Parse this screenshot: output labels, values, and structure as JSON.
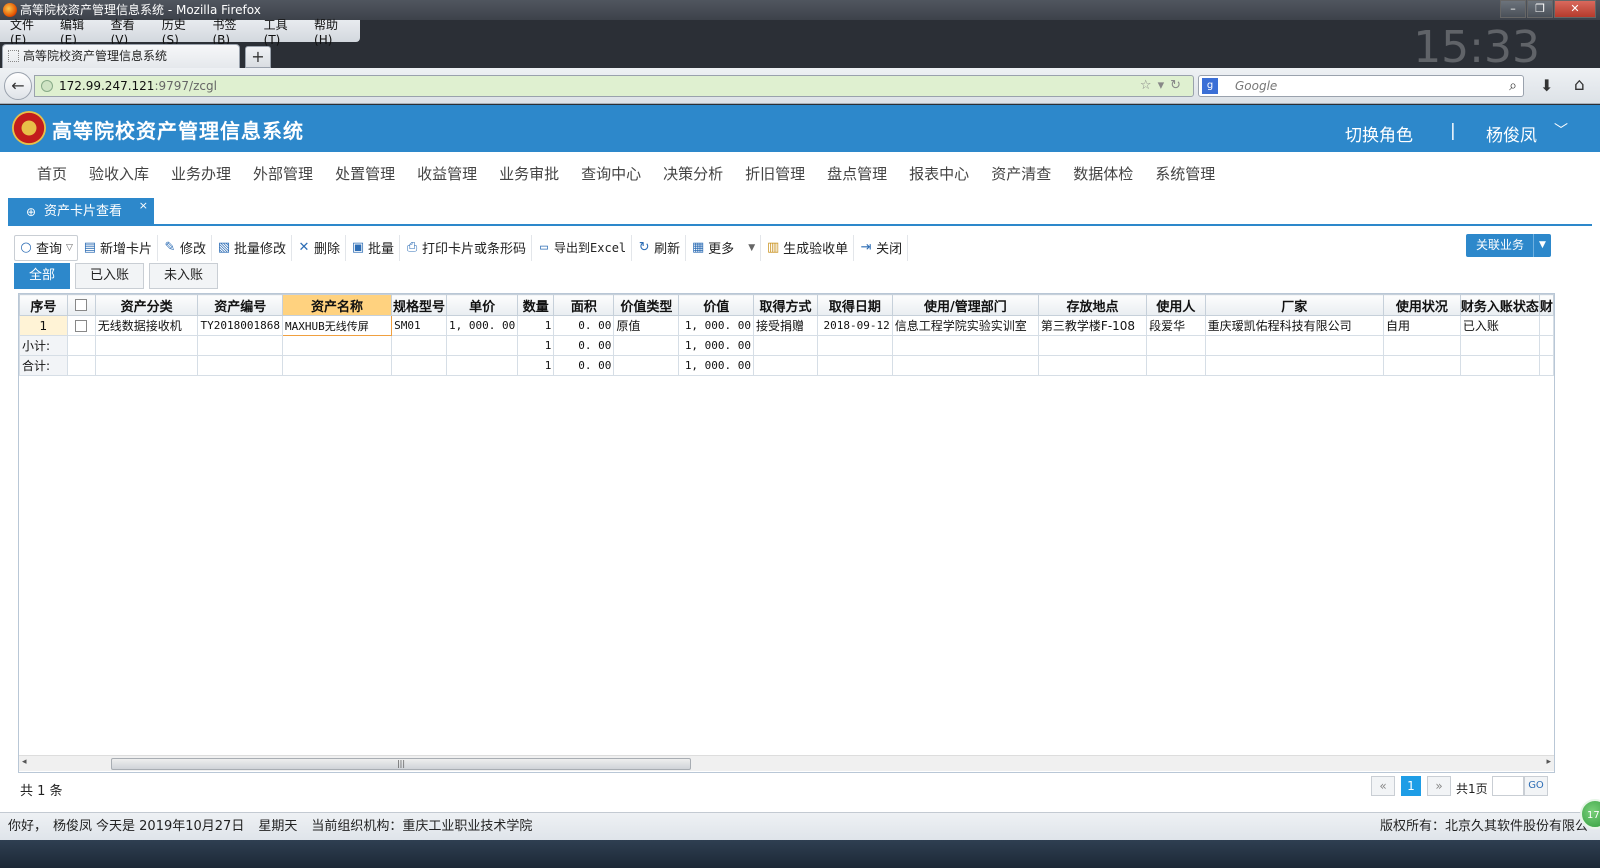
{
  "browser": {
    "window_title": "高等院校资产管理信息系统 - Mozilla Firefox",
    "menu": [
      "文件(F)",
      "编辑(E)",
      "查看(V)",
      "历史(S)",
      "书签(B)",
      "工具(T)",
      "帮助(H)"
    ],
    "tab_title": "高等院校资产管理信息系统",
    "url_host": "172.99.247.121",
    "url_path": ":9797/zcgl",
    "search_placeholder": "Google",
    "clock": "15:33"
  },
  "header": {
    "title": "高等院校资产管理信息系统",
    "switch_role": "切换角色",
    "separator": "|",
    "user": "杨俊凤",
    "accent_color": "#2d88cb"
  },
  "main_nav": [
    "首页",
    "验收入库",
    "业务办理",
    "外部管理",
    "处置管理",
    "收益管理",
    "业务审批",
    "查询中心",
    "决策分析",
    "折旧管理",
    "盘点管理",
    "报表中心",
    "资产清查",
    "数据体检",
    "系统管理"
  ],
  "page_tab": {
    "label": "资产卡片查看",
    "close": "×"
  },
  "toolbar": {
    "query": "查询",
    "add_card": "新增卡片",
    "edit": "修改",
    "batch_edit": "批量修改",
    "delete": "删除",
    "batch": "批量",
    "print": "打印卡片或条形码",
    "export": "导出到Excel",
    "refresh": "刷新",
    "more": "更多",
    "gen_receipt": "生成验收单",
    "close": "关闭",
    "assoc": "关联业务"
  },
  "filters": [
    "全部",
    "已入账",
    "未入账"
  ],
  "grid": {
    "headers": [
      "序号",
      "",
      "资产分类",
      "资产编号",
      "资产名称",
      "规格型号",
      "单价",
      "数量",
      "面积",
      "价值类型",
      "价值",
      "取得方式",
      "取得日期",
      "使用/管理部门",
      "存放地点",
      "使用人",
      "厂家",
      "使用状况",
      "财务入账状态",
      "财"
    ],
    "rows": [
      [
        "1",
        "",
        "无线数据接收机",
        "TY2018001868",
        "MAXHUB无线传屏",
        "SM01",
        "1, 000. 00",
        "1",
        "0. 00",
        "原值",
        "1, 000. 00",
        "接受捐赠",
        "2018-09-12",
        "信息工程学院实验实训室",
        "第三教学楼F-108",
        "段爱华",
        "重庆瑷凯佑程科技有限公司",
        "自用",
        "已入账",
        ""
      ]
    ],
    "subtotal": {
      "label": "小计:",
      "qty": "1",
      "area": "0. 00",
      "value": "1, 000. 00"
    },
    "total": {
      "label": "合计:",
      "qty": "1",
      "area": "0. 00",
      "value": "1, 000. 00"
    }
  },
  "pager": {
    "count_text": "共 1 条",
    "current_page": "1",
    "total_pages": "共1页",
    "go": "GO"
  },
  "status": {
    "greeting": "你好，",
    "user": "杨俊凤",
    "today": "今天是 2019年10月27日",
    "weekday": "星期天",
    "org": "当前组织机构：重庆工业职业技术学院",
    "copyright": "版权所有：北京久其软件股份有限公",
    "badge": "17"
  }
}
